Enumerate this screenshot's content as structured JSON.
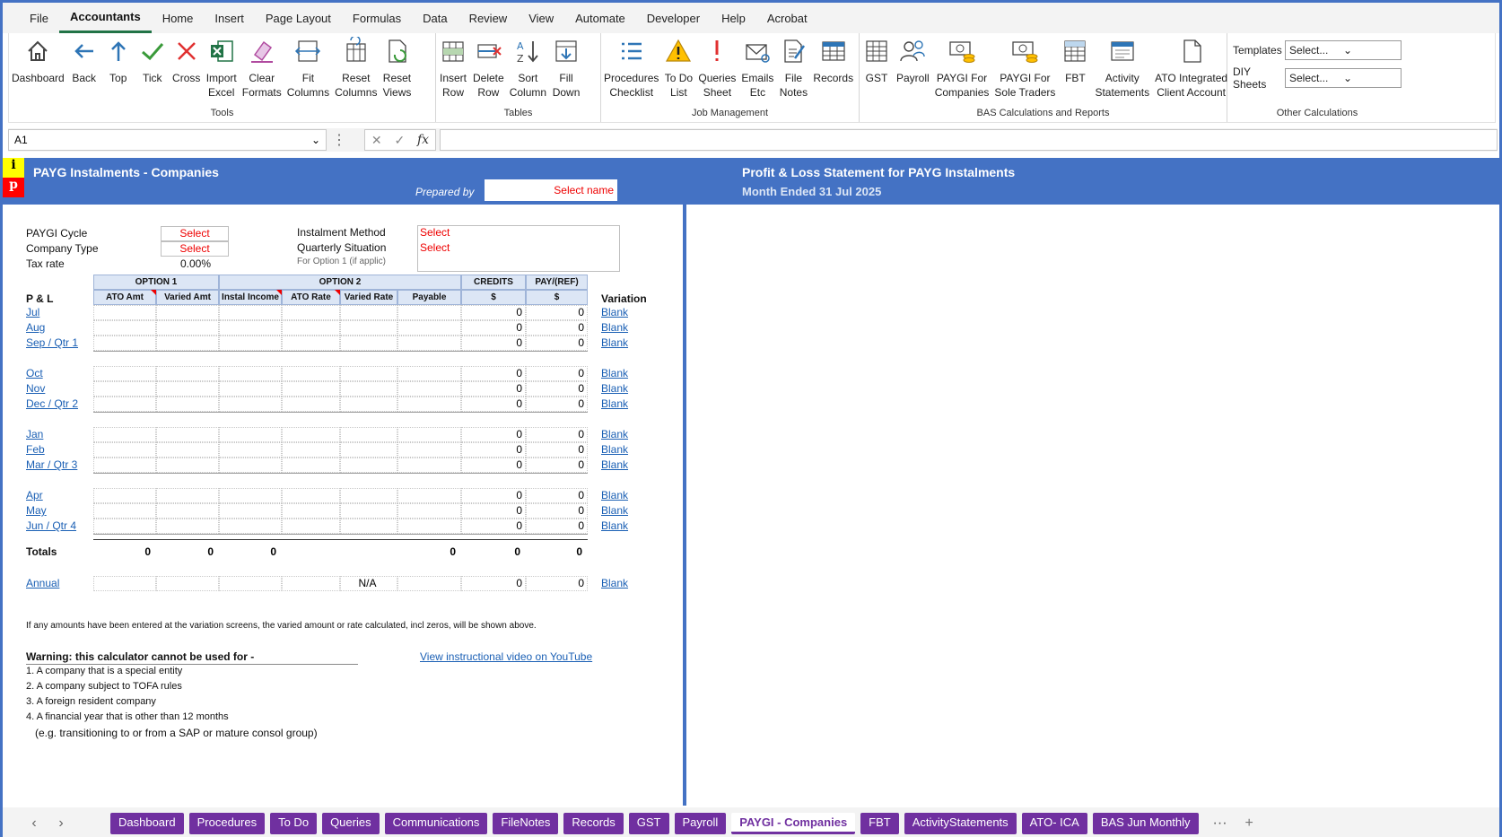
{
  "menu": [
    "File",
    "Accountants",
    "Home",
    "Insert",
    "Page Layout",
    "Formulas",
    "Data",
    "Review",
    "View",
    "Automate",
    "Developer",
    "Help",
    "Acrobat"
  ],
  "groups": {
    "tools": {
      "name": "Tools",
      "buttons": [
        "Dashboard",
        "Back",
        "Top",
        "Tick",
        "Cross",
        "Import\nExcel",
        "Clear\nFormats",
        "Fit\nColumns",
        "Reset\nColumns",
        "Reset\nViews"
      ]
    },
    "tables": {
      "name": "Tables",
      "buttons": [
        "Insert\nRow",
        "Delete\nRow",
        "Sort\nColumn",
        "Fill\nDown"
      ]
    },
    "job": {
      "name": "Job Management",
      "buttons": [
        "Procedures\nChecklist",
        "To Do\nList",
        "Queries\nSheet",
        "Emails\nEtc",
        "File\nNotes",
        "Records"
      ]
    },
    "bas": {
      "name": "BAS Calculations and Reports",
      "buttons": [
        "GST",
        "Payroll",
        "PAYGI For\nCompanies",
        "PAYGI For\nSole Traders",
        "FBT",
        "Activity\nStatements",
        "ATO Integrated\nClient Account"
      ]
    },
    "other": {
      "name": "Other Calculations",
      "templates_label": "Templates",
      "templates_value": "Select...",
      "diy_label": "DIY Sheets",
      "diy_value": "Select..."
    }
  },
  "formula": {
    "namebox": "A1",
    "fx": "fx"
  },
  "sheet": {
    "badge_i": "i",
    "badge_p": "p",
    "title": "PAYG Instalments - Companies",
    "prepared_label": "Prepared by",
    "prepared_value": "Select name",
    "right_title": "Profit & Loss Statement for PAYG Instalments",
    "right_sub": "Month Ended 31 Jul 2025",
    "paygi_cycle": "PAYGI Cycle",
    "company_type": "Company Type",
    "tax_rate": "Tax rate",
    "tax_rate_val": "0.00%",
    "select": "Select",
    "inst_method": "Instalment Method",
    "quarterly": "Quarterly Situation",
    "for_option": "For Option 1 (if applic)",
    "option1": "OPTION 1",
    "option2": "OPTION 2",
    "credits": "CREDITS",
    "payref": "PAY/(REF)",
    "col_ato_amt": "ATO Amt",
    "col_varied_amt": "Varied Amt",
    "col_instal": "Instal Income",
    "col_ato_rate": "ATO Rate",
    "col_varied_rate": "Varied Rate",
    "col_payable": "Payable",
    "col_dollar": "$",
    "pl": "P & L",
    "variation": "Variation",
    "months": [
      [
        "Jul",
        "Aug",
        "Sep / Qtr 1"
      ],
      [
        "Oct",
        "Nov",
        "Dec / Qtr 2"
      ],
      [
        "Jan",
        "Feb",
        "Mar / Qtr 3"
      ],
      [
        "Apr",
        "May",
        "Jun / Qtr 4"
      ]
    ],
    "zero": "0",
    "blank": "Blank",
    "totals": "Totals",
    "annual": "Annual",
    "na": "N/A",
    "note": "If any amounts have been entered at the variation screens, the varied amount or rate calculated, incl zeros, will be shown above.",
    "warning": "Warning:  this calculator cannot be used for -",
    "video": "View instructional video on YouTube",
    "warn_items": [
      "1. A company that is a special entity",
      "2. A company subject to TOFA rules",
      "3. A foreign resident company",
      "4. A financial year that is other than 12 months",
      "(e.g. transitioning to or from a SAP or mature consol group)"
    ]
  },
  "tabs": [
    "Dashboard",
    "Procedures",
    "To Do",
    "Queries",
    "Communications",
    "FileNotes",
    "Records",
    "GST",
    "Payroll",
    "PAYGI - Companies",
    "FBT",
    "ActivityStatements",
    "ATO- ICA",
    "BAS Jun Monthly"
  ],
  "active_tab": "PAYGI - Companies",
  "colors": {
    "accent": "#4472c4",
    "tab": "#7030a0",
    "excel": "#217346"
  }
}
